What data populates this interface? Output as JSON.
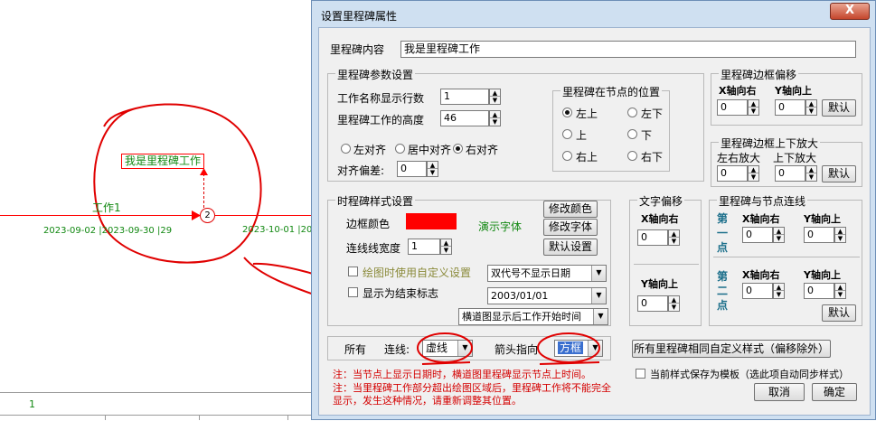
{
  "background": {
    "milestone_label": "我是里程碑工作",
    "task_label": "工作1",
    "node_number": "2",
    "date_left": "2023-09-02 |2023-09-30 |29",
    "date_right": "2023-10-01 |20",
    "bottom_cell": "1"
  },
  "dialog": {
    "title": "设置里程碑属性",
    "close_label": "X",
    "content_label": "里程碑内容",
    "content_value": "我是里程碑工作",
    "params": {
      "title": "里程碑参数设置",
      "lines_label": "工作名称显示行数",
      "lines_value": "1",
      "height_label": "里程碑工作的高度",
      "height_value": "46",
      "align_left": "左对齐",
      "align_center": "居中对齐",
      "align_right": "右对齐",
      "align_offset_label": "对齐偏差:",
      "align_offset_value": "0"
    },
    "position": {
      "title": "里程碑在节点的位置",
      "options": [
        "左上",
        "左下",
        "上",
        "下",
        "右上",
        "右下"
      ],
      "selected": "左上"
    },
    "border_offset": {
      "title": "里程碑边框偏移",
      "x_label": "X轴向右",
      "y_label": "Y轴向上",
      "x_value": "0",
      "y_value": "0",
      "default_label": "默认"
    },
    "border_zoom": {
      "title": "里程碑边框上下放大",
      "lr_label": "左右放大",
      "ud_label": "上下放大",
      "lr_value": "0",
      "ud_value": "0",
      "default_label": "默认"
    },
    "style": {
      "title": "时程碑样式设置",
      "border_color_label": "边框颜色",
      "border_color": "#ff0000",
      "demo_font_label": "演示字体",
      "modify_color": "修改颜色",
      "modify_font": "修改字体",
      "default_settings": "默认设置",
      "line_width_label": "连线线宽度",
      "line_width_value": "1",
      "custom_setting_label": "绘图时使用自定义设置",
      "end_flag_label": "显示为结束标志",
      "date_mode_value": "双代号不显示日期",
      "date_value": "2003/01/01",
      "time_mode_value": "横道图显示后工作开始时间"
    },
    "text_offset": {
      "title": "文字偏移",
      "x_label": "X轴向右",
      "y_label": "Y轴向上",
      "x_value": "0",
      "y_value": "0"
    },
    "node_link": {
      "title": "里程碑与节点连线",
      "first_point": "第一点",
      "second_point": "第二点",
      "x_label": "X轴向右",
      "y_label": "Y轴向上",
      "p1_x": "0",
      "p1_y": "0",
      "p2_x": "0",
      "p2_y": "0",
      "default_label": "默认"
    },
    "line_row": {
      "all_label": "所有",
      "line_label": "连线:",
      "line_value": "虚线",
      "arrow_label": "箭头指向",
      "arrow_value": "方框"
    },
    "all_same_button": "所有里程碑相同自定义样式（偏移除外）",
    "save_template_label": "当前样式保存为模板（选此项自动同步样式）",
    "note1": "注：当节点上显示日期时，横道图里程碑显示节点上时间。",
    "note2": "注：当里程碑工作部分超出绘图区域后，里程碑工作将不能完全显示，发生这种情况，请重新调整其位置。",
    "cancel_label": "取消",
    "ok_label": "确定",
    "colors": {
      "accent_red": "#ff0000",
      "demo_green": "#118811",
      "note_red": "#d40000"
    }
  }
}
